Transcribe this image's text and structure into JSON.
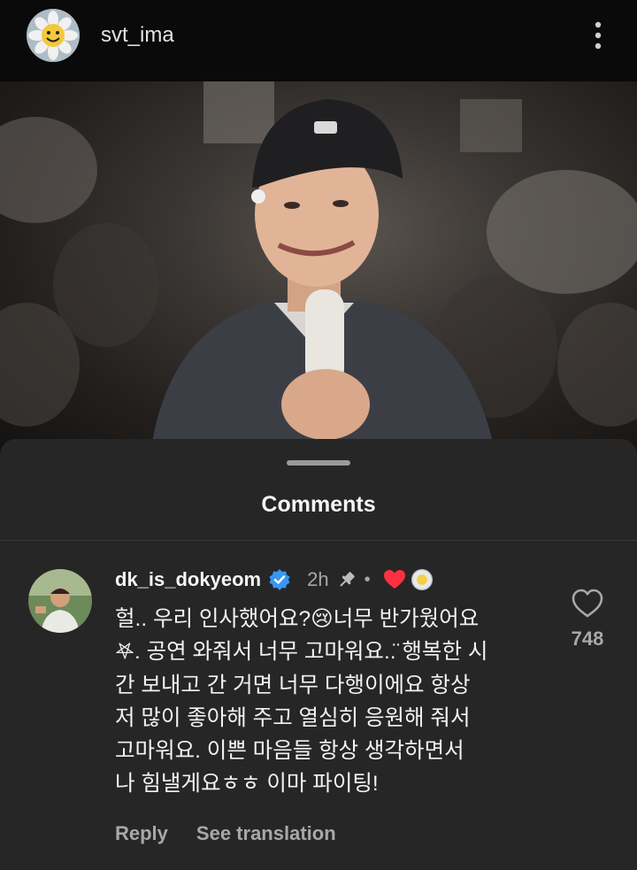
{
  "post": {
    "username": "svt_ima",
    "icons": {
      "avatar": "smiling-sunflower-avatar",
      "more": "more-vertical-icon"
    }
  },
  "comments_sheet": {
    "title": "Comments",
    "comment": {
      "username": "dk_is_dokyeom",
      "time": "2h",
      "separator": "•",
      "text": "헐.. 우리 인사했어요?😢너무 반가웠어요\n𖤐. 공연 와줘서 너무 고마워요..̈ 행복한 시\n간 보내고 간 거면 너무 다행이에요 항상\n저 많이 좋아해 주고 열심히 응원해 줘서\n고마워요. 이쁜 마음들 항상 생각하면서\n나 힘낼게요ㅎㅎ 이마 파이팅!",
      "like_count": "748",
      "actions": {
        "reply": "Reply",
        "see_translation": "See translation"
      },
      "icons": {
        "verified": "verified-badge-icon",
        "pinned": "pin-icon",
        "creator_liked": "heart-icon",
        "like": "heart-outline-icon"
      }
    }
  },
  "colors": {
    "sheet_bg": "#262626",
    "verified": "#3897f0",
    "liked_heart": "#ff3040",
    "muted_text": "#a8a8a8"
  }
}
